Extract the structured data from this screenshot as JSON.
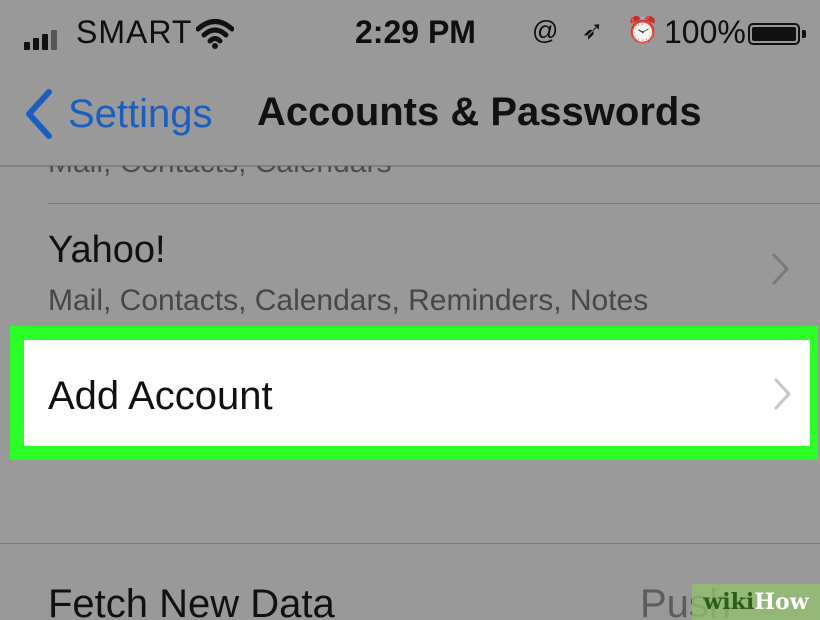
{
  "status_bar": {
    "carrier": "SMART",
    "time": "2:29 PM",
    "icons": "@ ➶ ⏰",
    "battery_percent": "100%"
  },
  "nav": {
    "back_label": "Settings",
    "title": "Accounts & Passwords"
  },
  "accounts": {
    "clipped_subtitle": "Mail, Contacts, Calendars",
    "yahoo": {
      "title": "Yahoo!",
      "subtitle": "Mail, Contacts, Calendars, Reminders, Notes"
    }
  },
  "add_account": {
    "label": "Add Account",
    "highlight_color": "#2cff27"
  },
  "fetch": {
    "label": "Fetch New Data",
    "value": "Push"
  },
  "watermark": {
    "wiki": "wiki",
    "how": "How"
  }
}
